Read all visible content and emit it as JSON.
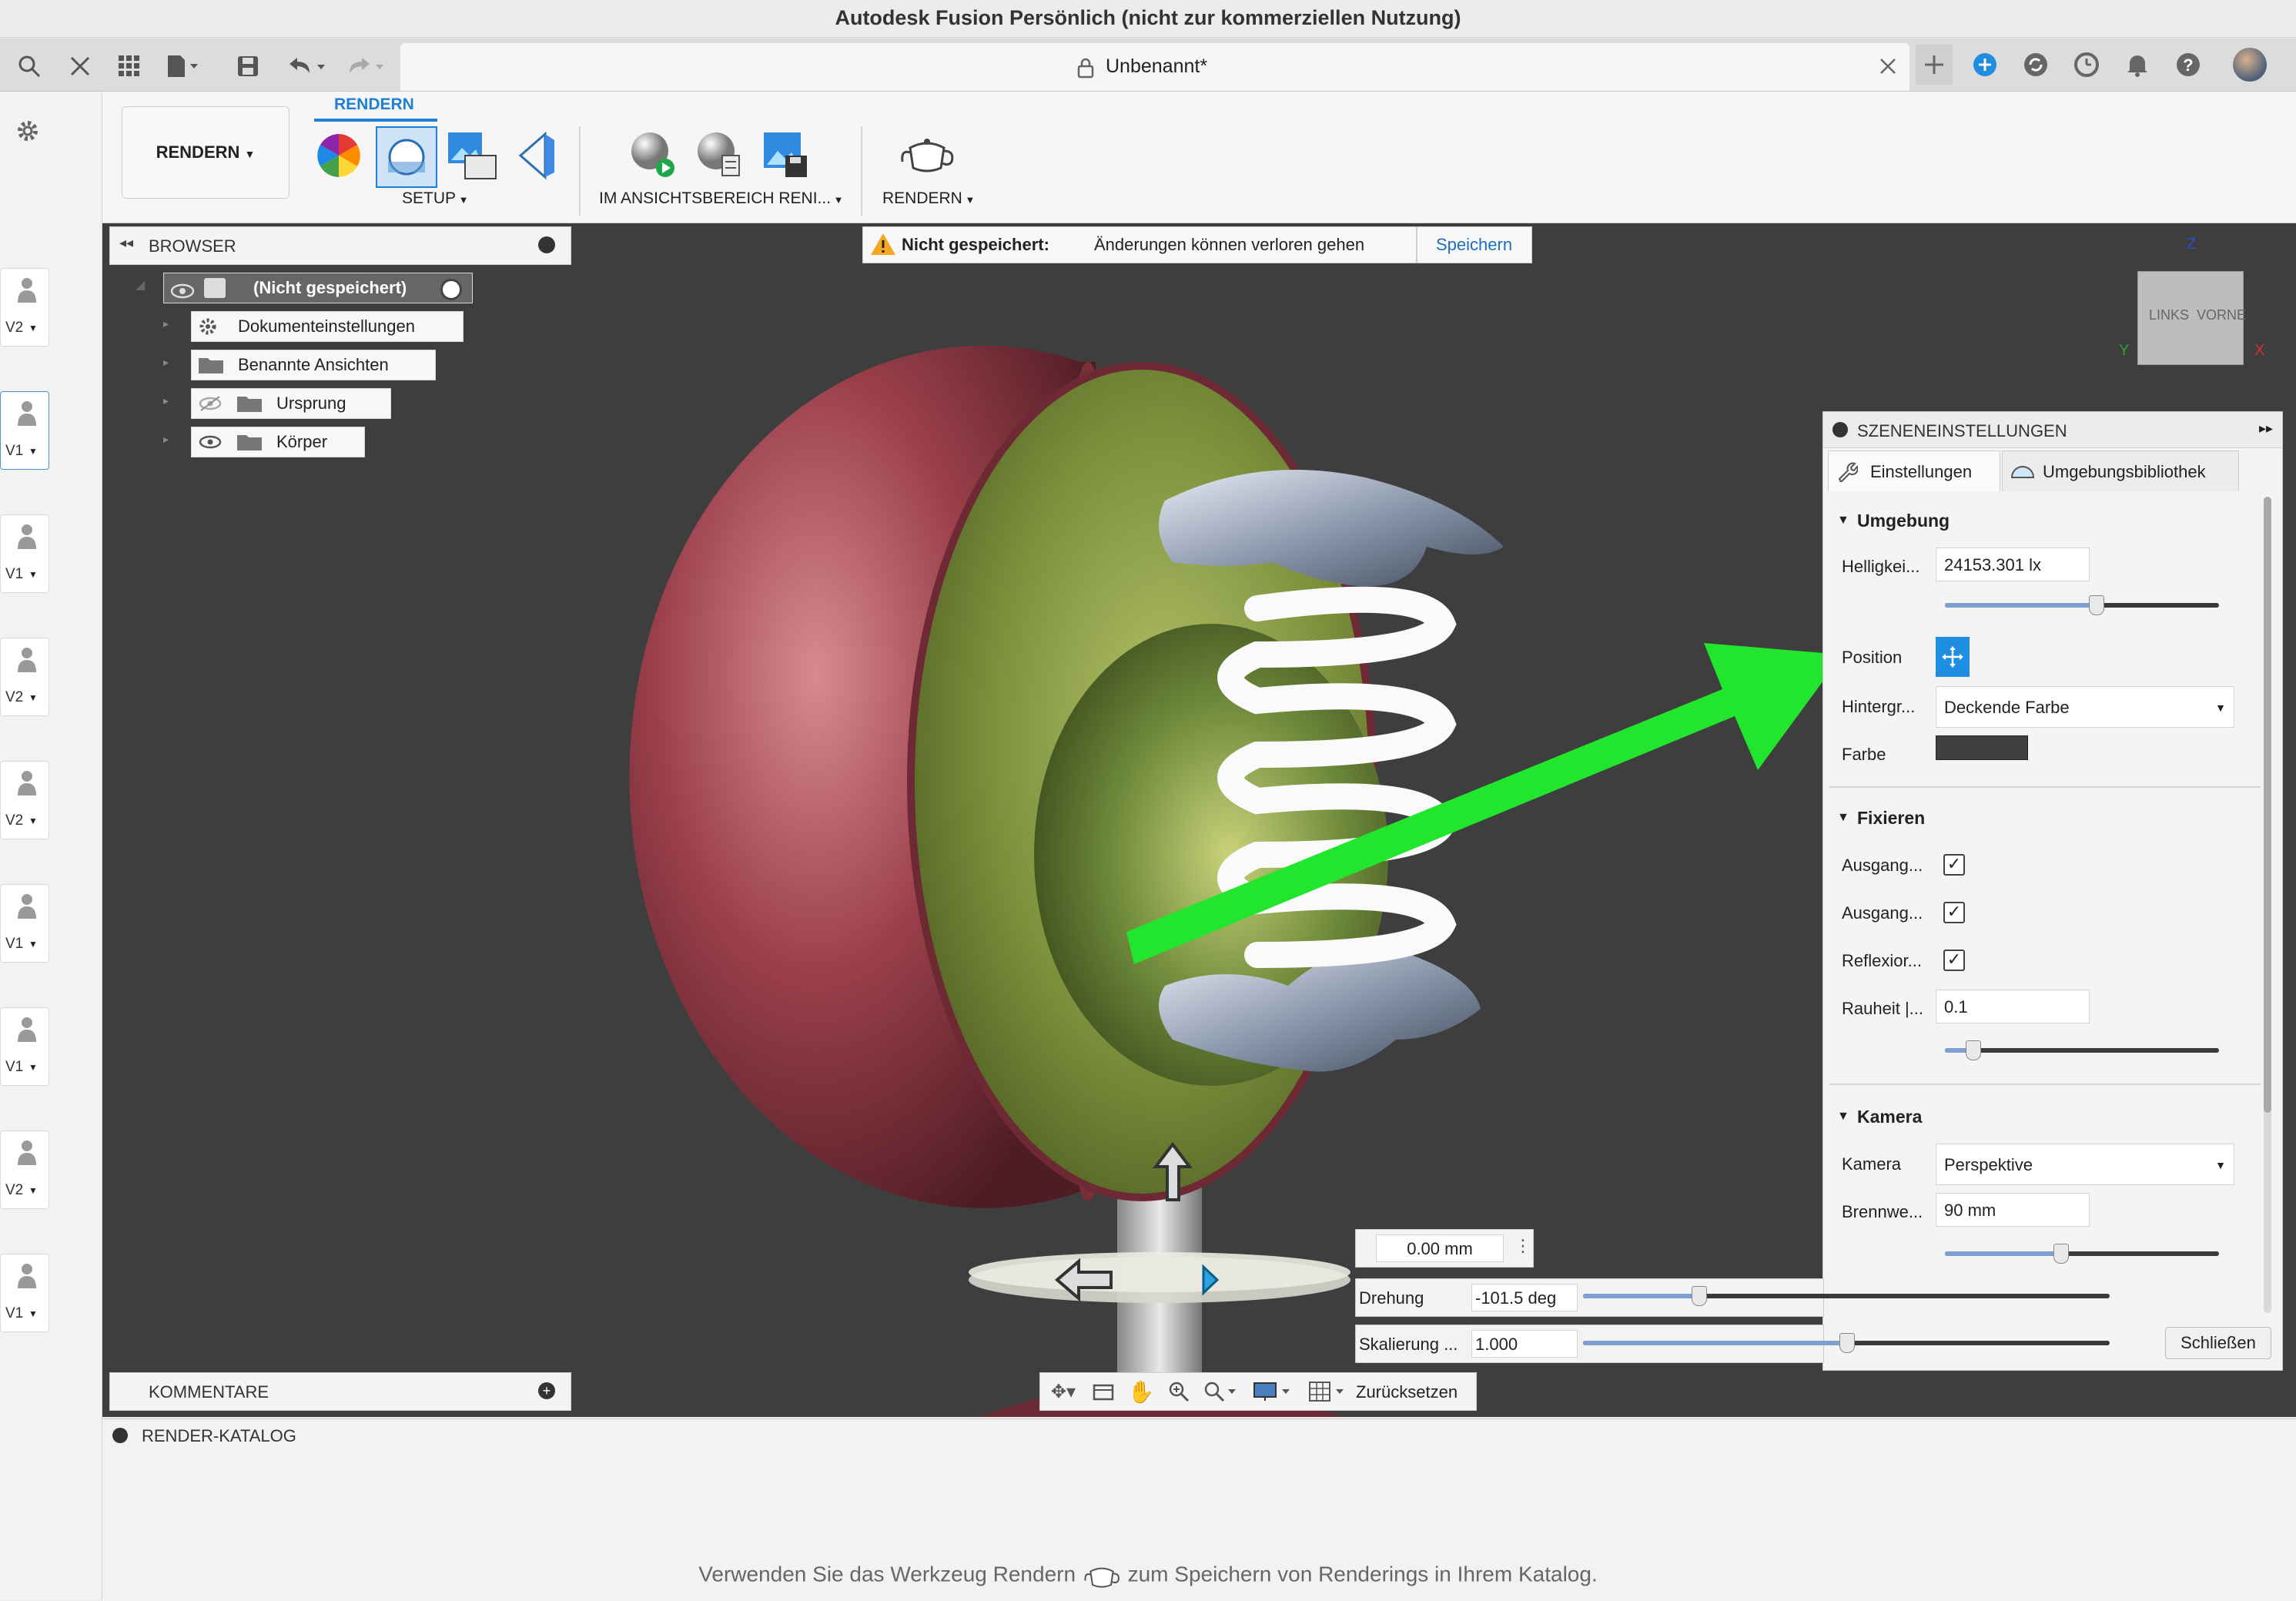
{
  "window": {
    "title": "Autodesk Fusion Persönlich (nicht zur kommerziellen Nutzung)"
  },
  "tab": {
    "title": "Unbenannt*"
  },
  "ribbon": {
    "workspace": "RENDERN",
    "active_tab": "RENDERN",
    "groups": {
      "setup": "SETUP",
      "viewport_render": "IM ANSICHTSBEREICH RENI...",
      "render": "RENDERN"
    }
  },
  "browser": {
    "title": "BROWSER",
    "root": "(Nicht gespeichert)",
    "items": [
      {
        "label": "Dokumenteinstellungen",
        "icon": "gear-icon"
      },
      {
        "label": "Benannte Ansichten",
        "icon": "folder-icon"
      },
      {
        "label": "Ursprung",
        "icon": "folder-icon"
      },
      {
        "label": "Körper",
        "icon": "folder-icon"
      }
    ]
  },
  "comments": {
    "title": "KOMMENTARE"
  },
  "warning": {
    "bold": "Nicht gespeichert:",
    "text": "Änderungen können verloren gehen",
    "save": "Speichern"
  },
  "viewcube": {
    "left": "LINKS",
    "front": "VORNE",
    "z": "Z",
    "x": "X",
    "y": "Y"
  },
  "scene": {
    "title": "SZENENEINSTELLUNGEN",
    "tabs": {
      "settings": "Einstellungen",
      "library": "Umgebungsbibliothek"
    },
    "environment": {
      "header": "Umgebung",
      "brightness_label": "Helligkei...",
      "brightness_value": "24153.301 lx",
      "brightness_slider": 0.55,
      "position_label": "Position",
      "background_label": "Hintergr...",
      "background_value": "Deckende Farbe",
      "color_label": "Farbe",
      "color_value": "#404040"
    },
    "fix": {
      "header": "Fixieren",
      "rows": [
        {
          "label": "Ausgang...",
          "checked": true
        },
        {
          "label": "Ausgang...",
          "checked": true
        },
        {
          "label": "Reflexior...",
          "checked": true
        }
      ],
      "roughness_label": "Rauheit |...",
      "roughness_value": "0.1",
      "roughness_slider": 0.1
    },
    "camera": {
      "header": "Kamera",
      "camera_label": "Kamera",
      "camera_value": "Perspektive",
      "focal_label": "Brennwe...",
      "focal_value": "90 mm",
      "focal_slider": 0.42
    },
    "close": "Schließen"
  },
  "transform": {
    "distance": "0.00 mm",
    "rotation_label": "Drehung",
    "rotation_value": "-101.5 deg",
    "rotation_slider": 0.22,
    "scale_label": "Skalierung ...",
    "scale_value": "1.000",
    "scale_slider": 0.5
  },
  "navbar": {
    "reset": "Zurücksetzen"
  },
  "catalog": {
    "title": "RENDER-KATALOG",
    "hint_a": "Verwenden Sie das Werkzeug Rendern",
    "hint_b": "zum Speichern von Renderings in Ihrem Katalog."
  },
  "versions": [
    "V2",
    "V1",
    "V1",
    "V2",
    "V2",
    "V1",
    "V1",
    "V2",
    "V1"
  ]
}
